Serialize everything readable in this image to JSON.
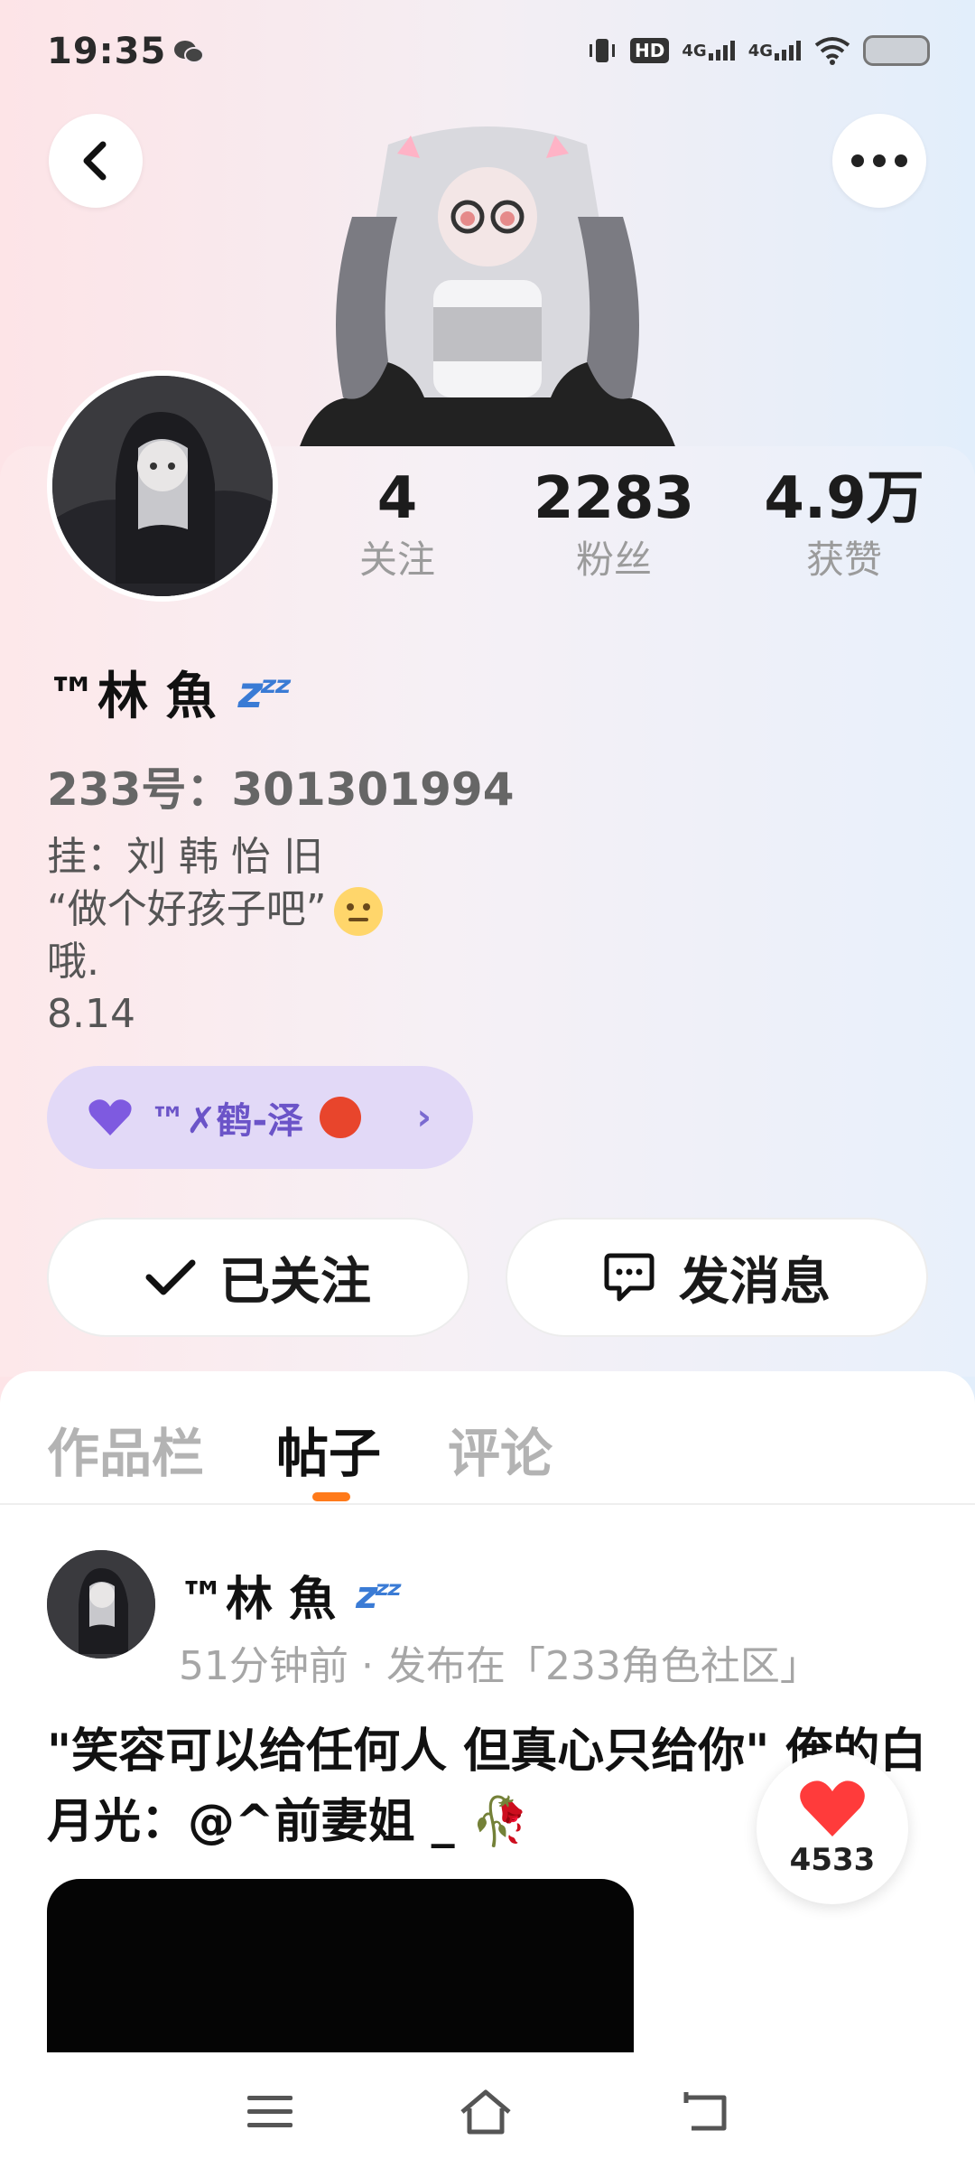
{
  "status_bar": {
    "time": "19:35",
    "hd_label": "HD",
    "signal_1": "4G",
    "signal_2": "4G"
  },
  "profile": {
    "stats": [
      {
        "value": "4",
        "label": "关注"
      },
      {
        "value": "2283",
        "label": "粉丝"
      },
      {
        "value": "4.9万",
        "label": "获赞"
      }
    ],
    "nickname": "™林 魚",
    "account_id": "233号：301301994",
    "bio_lines": [
      "挂：刘 韩 怡 旧",
      "“做个好孩子吧”",
      "哦.",
      "8.14"
    ],
    "couple_badge": "™✗鹤-泽"
  },
  "actions": {
    "follow_label": "已关注",
    "message_label": "发消息"
  },
  "tabs": [
    {
      "label": "作品栏"
    },
    {
      "label": "帖子"
    },
    {
      "label": "评论"
    }
  ],
  "post": {
    "author": "™林 魚",
    "meta": "51分钟前 · 发布在「233角色社区」",
    "text": "\"笑容可以给任何人 但真心只给你\" 俺的白月光：@^前妻姐 _ 🥀",
    "like_count": "4533"
  },
  "colors": {
    "accent": "#ff7a1a",
    "badge_bg": "#e2d9f7",
    "badge_text": "#6b54c8",
    "heart": "#ff3b3b"
  },
  "icons": {
    "back": "chevron-left-icon",
    "more": "more-horizontal-icon",
    "follow": "check-icon",
    "message": "chat-bubble-icon",
    "like": "heart-icon"
  }
}
